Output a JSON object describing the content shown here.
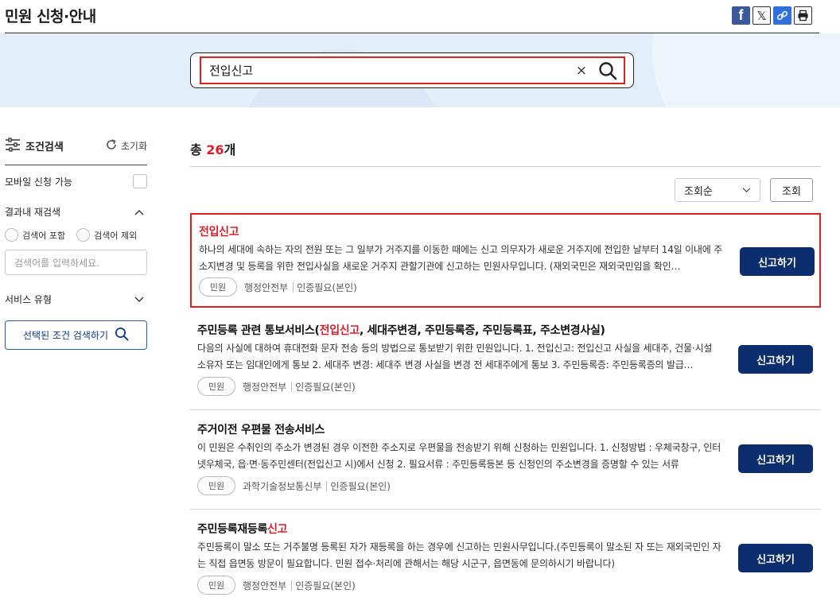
{
  "page": {
    "title": "민원 신청·안내"
  },
  "share": {
    "facebook_icon": "facebook-icon",
    "x_icon": "x-icon",
    "link_icon": "link-icon",
    "print_icon": "print-icon"
  },
  "search": {
    "value": "전입신고",
    "clear_label": "×"
  },
  "filter": {
    "title": "조건검색",
    "reset_label": "초기화",
    "mobile_label": "모바일 신청 가능",
    "refine_label": "결과내 재검색",
    "radio_include": "검색어 포함",
    "radio_exclude": "검색어 제외",
    "keyword_placeholder": "검색어를 입력하세요.",
    "service_type_label": "서비스 유형",
    "apply_label": "선택된 조건 검색하기"
  },
  "results": {
    "total_prefix": "총 ",
    "total_count": "26",
    "total_suffix": "개",
    "sort_value": "조회순",
    "sort_button": "조회",
    "apply_label": "신고하기",
    "items": [
      {
        "title_pre": "",
        "title_hl": "전입신고",
        "title_post": "",
        "desc": "하나의 세대에 속하는 자의 전원 또는 그 일부가 거주지를 이동한 때에는 신고 의무자가 새로운 거주지에 전입한 날부터 14일 이내에 주소지변경 및 등록을 위한 전입사실을 새로운 거주지 관할기관에 신고하는 민원사무입니다. (재외국민은 재외국민임을 확인…",
        "tag": "민원",
        "agency": "행정안전부",
        "auth": "인증필요(본인)"
      },
      {
        "title_pre": "주민등록 관련 통보서비스(",
        "title_hl": "전입신고",
        "title_post": ", 세대주변경, 주민등록증, 주민등록표, 주소변경사실)",
        "desc": "다음의 사실에 대하여 휴대전화 문자 전송 등의 방법으로 통보받기 위한 민원입니다. 1. 전입신고: 전입신고 사실을 세대주, 건물·시설 소유자 또는 임대인에게 통보 2. 세대주 변경: 세대주 변경 사실을 변경 전 세대주에게 통보 3. 주민등록증: 주민등록증의 발급…",
        "tag": "민원",
        "agency": "행정안전부",
        "auth": "인증필요(본인)"
      },
      {
        "title_pre": "주거이전 우편물 전송서비스",
        "title_hl": "",
        "title_post": "",
        "desc": "이 민원은 수취인의 주소가 변경된 경우 이전한 주소지로 우편물을 전송받기 위해 신청하는 민원입니다. 1. 신청방법 : 우체국창구, 인터넷우체국, 읍·면·동주민센터(전입신고 시)에서 신청 2. 필요서류 : 주민등록등본 등 신청인의 주소변경을 증명할 수 있는 서류",
        "tag": "민원",
        "agency": "과학기술정보통신부",
        "auth": "인증필요(본인)"
      },
      {
        "title_pre": "주민등록재등록",
        "title_hl": "신고",
        "title_post": "",
        "desc": "주민등록이 말소 또는 거주불명 등록된 자가 재등록을 하는 경우에 신고하는 민원사무입니다.(주민등록이 말소된 자 또는 재외국민인 자는 직접 읍면동 방문이 필요합니다. 민원 접수·처리에 관해서는 해당 시군구, 읍면동에 문의하시기 바랍니다)",
        "tag": "민원",
        "agency": "행정안전부",
        "auth": "인증필요(본인)"
      }
    ]
  }
}
